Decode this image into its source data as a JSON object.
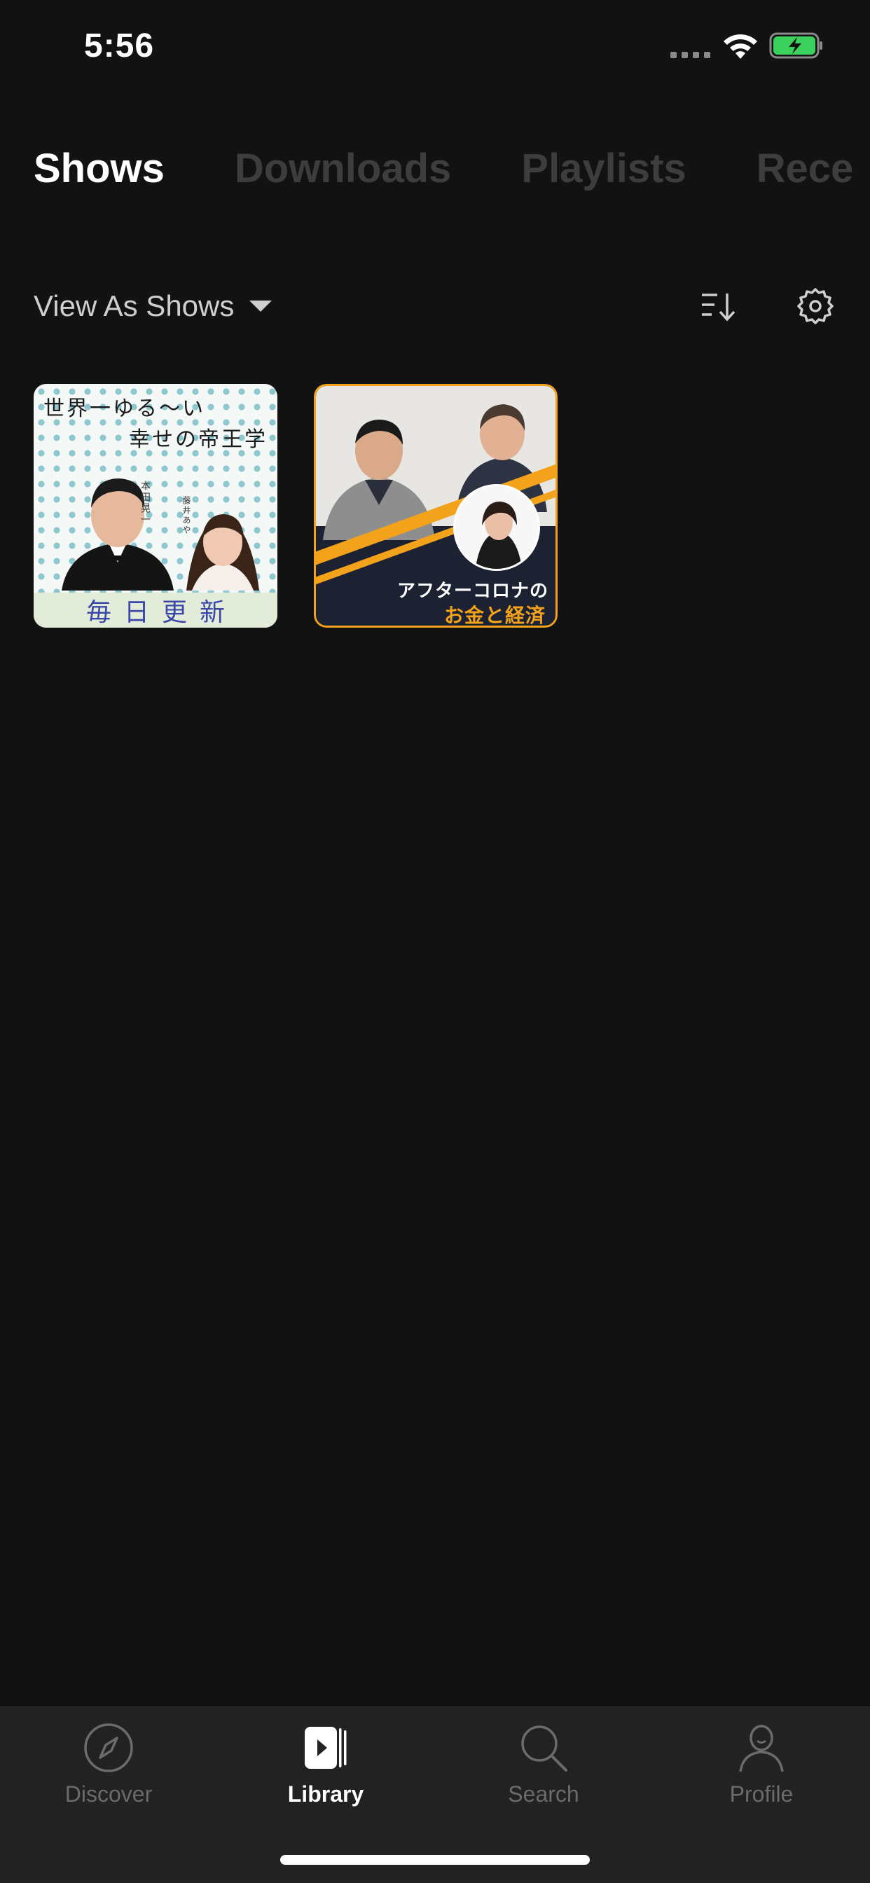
{
  "status_bar": {
    "time": "5:56",
    "battery_color": "#3ad15d"
  },
  "library_tabs": [
    {
      "label": "Shows",
      "active": true
    },
    {
      "label": "Downloads",
      "active": false
    },
    {
      "label": "Playlists",
      "active": false
    },
    {
      "label": "Rece",
      "active": false
    }
  ],
  "view_bar": {
    "view_as_label": "View As Shows",
    "icons": [
      "chevron-down-icon",
      "sort-icon",
      "gear-icon"
    ]
  },
  "shows": [
    {
      "title_line1": "世界一ゆる〜い",
      "title_line2": "幸せの帝王学",
      "host_name1": "本田晃一",
      "host_name2": "藤井あや",
      "banner": "毎日更新"
    },
    {
      "title_line1": "アフターコロナの",
      "title_line2": "お金と経済",
      "accent_color": "#f3a21b"
    }
  ],
  "bottom_nav": [
    {
      "label": "Discover",
      "icon": "compass-icon",
      "active": false
    },
    {
      "label": "Library",
      "icon": "library-icon",
      "active": true
    },
    {
      "label": "Search",
      "icon": "search-icon",
      "active": false
    },
    {
      "label": "Profile",
      "icon": "profile-icon",
      "active": false
    }
  ],
  "colors": {
    "background": "#121212",
    "tab_bar": "#222222",
    "inactive": "#6b6b6b"
  }
}
